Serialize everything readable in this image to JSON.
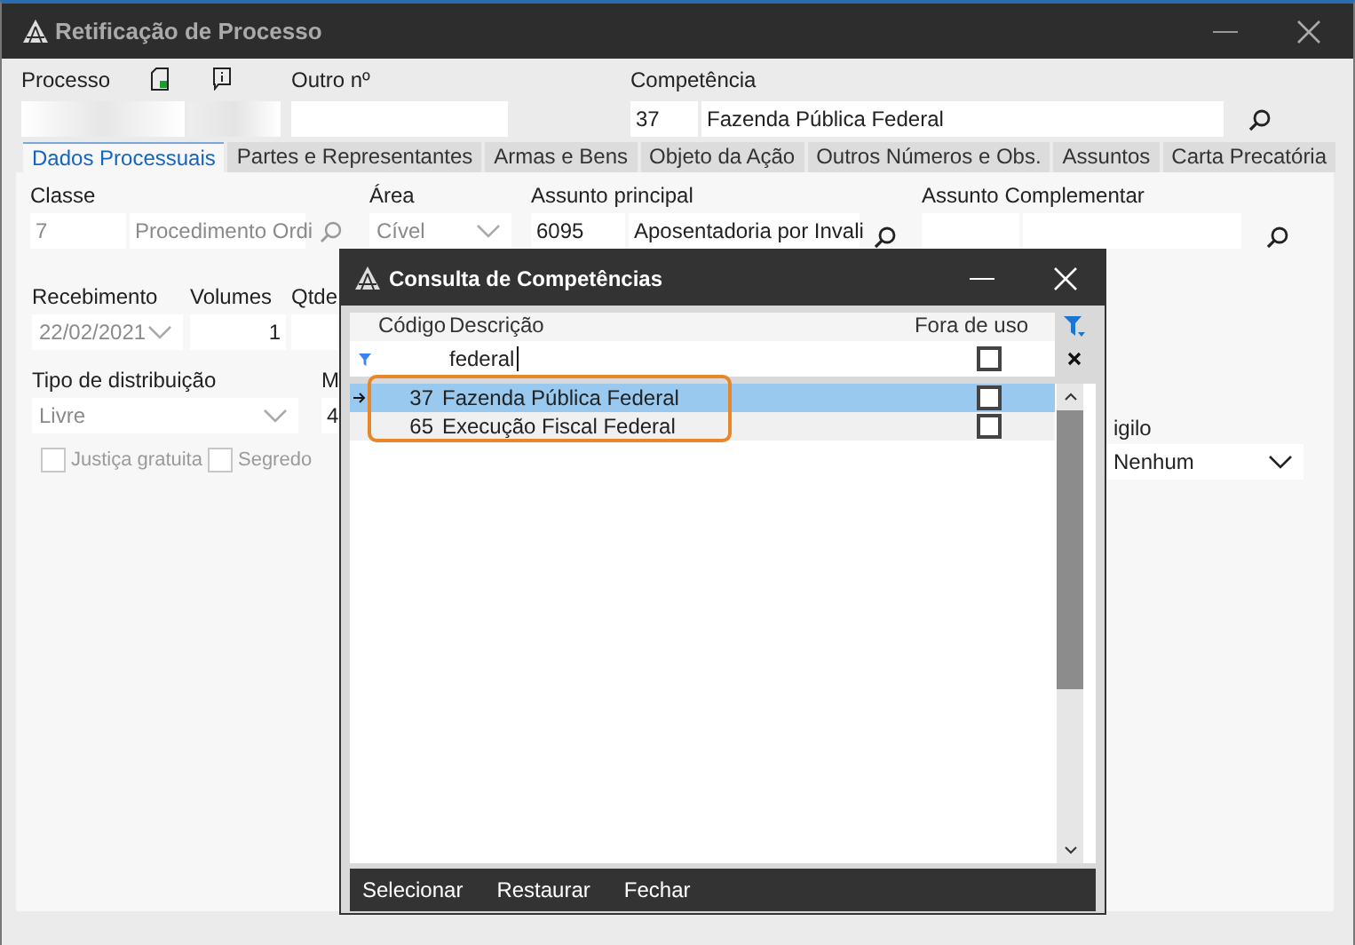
{
  "window": {
    "title": "Retificação de Processo"
  },
  "processo": {
    "label": "Processo"
  },
  "outro": {
    "label": "Outro nº"
  },
  "competencia": {
    "label": "Competência",
    "code": "37",
    "description": "Fazenda Pública Federal"
  },
  "tabs": [
    {
      "label": "Dados Processuais",
      "selected": true
    },
    {
      "label": "Partes e Representantes",
      "selected": false
    },
    {
      "label": "Armas e Bens",
      "selected": false
    },
    {
      "label": "Objeto da Ação",
      "selected": false
    },
    {
      "label": "Outros Números e Obs.",
      "selected": false
    },
    {
      "label": "Assuntos",
      "selected": false
    },
    {
      "label": "Carta Precatória",
      "selected": false
    }
  ],
  "form": {
    "classe": {
      "label": "Classe",
      "code": "7",
      "description": "Procedimento Ordi",
      "disabled": true
    },
    "area": {
      "label": "Área",
      "value": "Cível",
      "disabled": true
    },
    "assunto_principal": {
      "label": "Assunto principal",
      "code": "6095",
      "description": "Aposentadoria por Invali"
    },
    "assunto_complementar": {
      "label": "Assunto Complementar"
    },
    "recebimento": {
      "label": "Recebimento",
      "value": "22/02/2021",
      "disabled": true
    },
    "volumes": {
      "label": "Volumes",
      "value": "1"
    },
    "qtde": {
      "label": "Qtde"
    },
    "tipo_distribuicao": {
      "label": "Tipo de distribuição",
      "value": "Livre",
      "disabled": true
    },
    "field_m": {
      "label": "M",
      "value": "4"
    },
    "checkboxes": [
      {
        "label": "Justiça gratuita",
        "checked": false,
        "disabled": true
      },
      {
        "label": "Segredo",
        "checked": false,
        "disabled": true
      }
    ],
    "sigilo": {
      "label": "igilo",
      "value": "Nenhum"
    }
  },
  "dialog": {
    "title": "Consulta de Competências",
    "columns": [
      "Código",
      "Descrição",
      "Fora de uso"
    ],
    "filter": {
      "description": "federal",
      "fora_de_uso_checked": false
    },
    "rows": [
      {
        "code": "37",
        "description": "Fazenda Pública Federal",
        "fora_de_uso": false,
        "selected": true,
        "current": true
      },
      {
        "code": "65",
        "description": "Execução Fiscal Federal",
        "fora_de_uso": false,
        "selected": false,
        "current": false
      }
    ],
    "buttons": [
      "Selecionar",
      "Restaurar",
      "Fechar"
    ]
  }
}
